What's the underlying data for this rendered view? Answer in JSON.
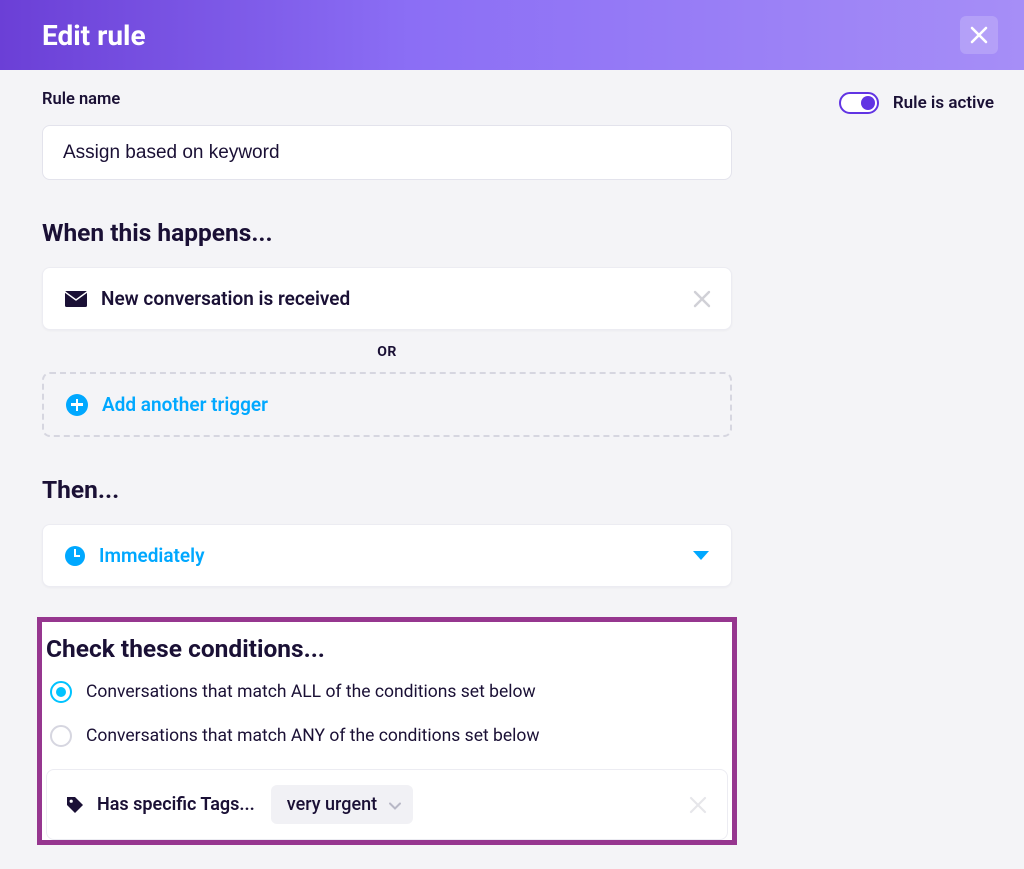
{
  "header": {
    "title": "Edit rule"
  },
  "rule_name": {
    "label": "Rule name",
    "value": "Assign based on keyword"
  },
  "active_toggle": {
    "label": "Rule is active",
    "on": true
  },
  "triggers": {
    "title": "When this happens...",
    "items": [
      {
        "icon": "inbox-icon",
        "label": "New conversation is received"
      }
    ],
    "separator": "OR",
    "add_label": "Add another trigger"
  },
  "timing": {
    "title": "Then...",
    "selected": "Immediately"
  },
  "conditions": {
    "title": "Check these conditions...",
    "match_all_label": "Conversations that match ALL of the conditions set below",
    "match_any_label": "Conversations that match ANY of the conditions set below",
    "selected_mode": "all",
    "rows": [
      {
        "type_label": "Has specific Tags...",
        "value": "very urgent"
      }
    ]
  }
}
